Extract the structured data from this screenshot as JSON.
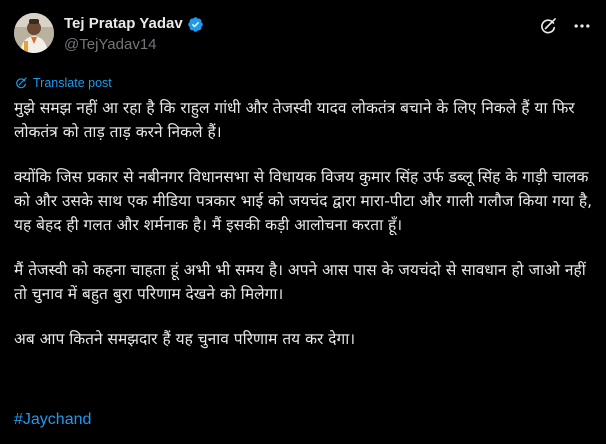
{
  "author": {
    "display_name": "Tej Pratap Yadav",
    "handle": "@TejYadav14",
    "verified": true,
    "avatar": "profile-photo"
  },
  "actions": {
    "grok_icon": "grok-icon",
    "more_icon": "more-options-icon"
  },
  "translate": {
    "label": "Translate post",
    "icon": "translate-icon"
  },
  "post": {
    "paragraphs": [
      "मुझे समझ नहीं आ रहा है कि राहुल गांधी और तेजस्वी यादव लोकतंत्र बचाने के लिए निकले हैं या फिर लोकतंत्र को ताड़ ताड़ करने निकले हैं।",
      "क्योंकि जिस प्रकार से नबीनगर विधानसभा से विधायक विजय कुमार सिंह उर्फ डब्लू सिंह के गाड़ी चालक को और उसके साथ एक मीडिया पत्रकार भाई को जयचंद द्वारा मारा-पीटा और गाली गलौज किया गया है, यह बेहद ही गलत और शर्मनाक है। मैं इसकी कड़ी आलोचना करता हूँ।",
      "मैं तेजस्वी को कहना चाहता हूं अभी भी समय है। अपने आस पास के जयचंदो से सावधान हो जाओ नहीं तो चुनाव में बहुत बुरा परिणाम देखने को मिलेगा।",
      "अब आप कितने समझदार हैं यह चुनाव परिणाम तय कर देगा।"
    ],
    "hashtag": "#Jaychand"
  },
  "colors": {
    "background": "#000000",
    "text": "#e7e9ea",
    "muted": "#71767b",
    "accent": "#1d9bf0"
  }
}
